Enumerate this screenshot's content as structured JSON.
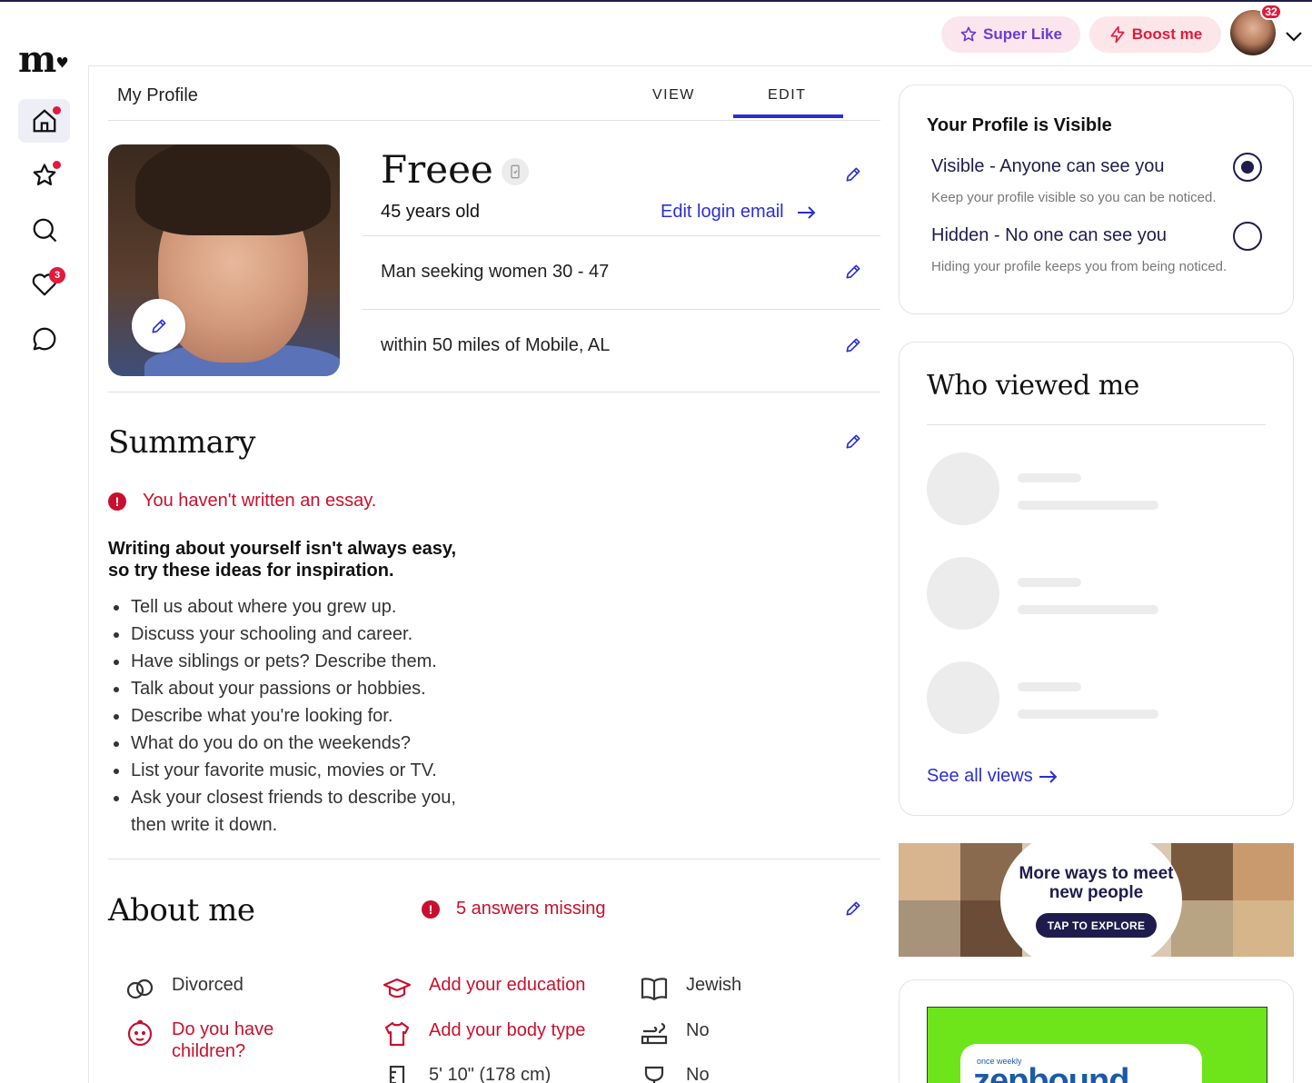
{
  "brand": {
    "logo_text": "m",
    "logo_mark": "♥"
  },
  "topbar": {
    "super_like_label": "Super Like",
    "boost_label": "Boost me",
    "notification_count": "32"
  },
  "sidebar": {
    "items": [
      {
        "icon": "home-icon",
        "active": true,
        "dot": true
      },
      {
        "icon": "star-icon",
        "dot": true
      },
      {
        "icon": "search-icon"
      },
      {
        "icon": "heart-icon",
        "badge": "3"
      },
      {
        "icon": "chat-icon"
      }
    ]
  },
  "header": {
    "title": "My Profile",
    "tabs": [
      {
        "label": "VIEW"
      },
      {
        "label": "EDIT",
        "active": true
      }
    ]
  },
  "profile": {
    "name": "Freee",
    "age": "45 years old",
    "edit_login_label": "Edit login email",
    "seeking": "Man seeking women 30 - 47",
    "location": "within 50 miles of Mobile, AL"
  },
  "summary": {
    "title": "Summary",
    "warning": "You haven't written an essay.",
    "inspire_line1": "Writing about yourself isn't always easy,",
    "inspire_line2": "so try these ideas for inspiration.",
    "ideas": [
      "Tell us about where you grew up.",
      "Discuss your schooling and career.",
      "Have siblings or pets? Describe them.",
      "Talk about your passions or hobbies.",
      "Describe what you're looking for.",
      "What do you do on the weekends?",
      "List your favorite music, movies or TV.",
      "Ask your closest friends to describe you, then write it down."
    ]
  },
  "about": {
    "title": "About me",
    "warning": "5 answers missing",
    "items": [
      {
        "icon": "rings-icon",
        "label": "Divorced",
        "missing": false
      },
      {
        "icon": "graduation-cap-icon",
        "label": "Add your education",
        "missing": true
      },
      {
        "icon": "book-icon",
        "label": "Jewish",
        "missing": false
      },
      {
        "icon": "baby-face-icon",
        "label": "Do you have children?",
        "missing": true
      },
      {
        "icon": "shirt-icon",
        "label": "Add your body type",
        "missing": true
      },
      {
        "icon": "smoking-icon",
        "label": "No",
        "missing": false
      },
      {
        "icon": "ruler-icon",
        "label": "5' 10\" (178 cm)",
        "missing": false
      },
      {
        "icon": "wine-glass-icon",
        "label": "No",
        "missing": false
      }
    ]
  },
  "visibility": {
    "title": "Your Profile is Visible",
    "options": [
      {
        "label": "Visible - Anyone can see you",
        "desc": "Keep your profile visible so you can be noticed.",
        "selected": true
      },
      {
        "label": "Hidden - No one can see you",
        "desc": "Hiding your profile keeps you from being noticed.",
        "selected": false
      }
    ]
  },
  "viewers": {
    "title": "Who viewed me",
    "see_all_label": "See all views"
  },
  "promo": {
    "headline": "More ways to meet new people",
    "cta": "TAP TO EXPLORE"
  },
  "ad": {
    "small_text": "once weekly",
    "brand": "zepbound"
  },
  "colors": {
    "accent_blue": "#2b2fd1",
    "alert_red": "#c8102e",
    "navy": "#1f1c4d"
  }
}
